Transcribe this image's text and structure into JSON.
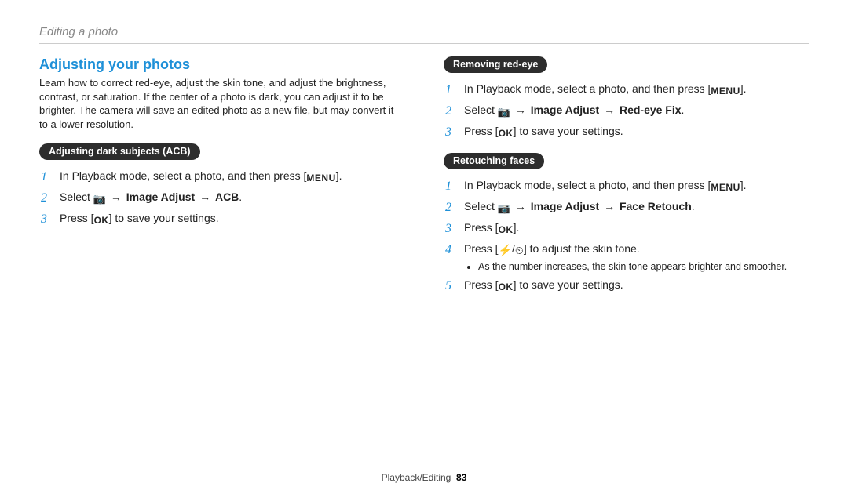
{
  "header": {
    "breadcrumb": "Editing a photo"
  },
  "left": {
    "heading": "Adjusting your photos",
    "intro": "Learn how to correct red-eye, adjust the skin tone, and adjust the brightness, contrast, or saturation. If the center of a photo is dark, you can adjust it to be brighter. The camera will save an edited photo as a new file, but may convert it to a lower resolution.",
    "sec1_title": "Adjusting dark subjects (ACB)",
    "sec1_step1_a": "In Playback mode, select a photo, and then press [",
    "sec1_step1_menu": "MENU",
    "sec1_step1_b": "].",
    "sec1_step2_a": "Select ",
    "sec1_step2_b": "Image Adjust",
    "sec1_step2_c": "ACB",
    "sec1_step3_a": "Press [",
    "sec1_step3_ok": "OK",
    "sec1_step3_b": "] to save your settings."
  },
  "right": {
    "sec2_title": "Removing red-eye",
    "sec2_step1_a": "In Playback mode, select a photo, and then press [",
    "sec2_step1_menu": "MENU",
    "sec2_step1_b": "].",
    "sec2_step2_a": "Select ",
    "sec2_step2_b": "Image Adjust",
    "sec2_step2_c": "Red-eye Fix",
    "sec2_step3_a": "Press [",
    "sec2_step3_ok": "OK",
    "sec2_step3_b": "] to save your settings.",
    "sec3_title": "Retouching faces",
    "sec3_step1_a": "In Playback mode, select a photo, and then press [",
    "sec3_step1_menu": "MENU",
    "sec3_step1_b": "].",
    "sec3_step2_a": "Select ",
    "sec3_step2_b": "Image Adjust",
    "sec3_step2_c": "Face Retouch",
    "sec3_step3_a": "Press [",
    "sec3_step3_ok": "OK",
    "sec3_step3_b": "].",
    "sec3_step4_a": "Press [",
    "sec3_step4_flash": "⚡",
    "sec3_step4_slash": "/",
    "sec3_step4_timer": "⏲",
    "sec3_step4_b": "] to adjust the skin tone.",
    "sec3_step4_bullet": "As the number increases, the skin tone appears brighter and smoother.",
    "sec3_step5_a": "Press [",
    "sec3_step5_ok": "OK",
    "sec3_step5_b": "] to save your settings."
  },
  "icons": {
    "arrow": "→",
    "camera": "📷",
    "period": "."
  },
  "footer": {
    "section": "Playback/Editing",
    "page": "83"
  }
}
